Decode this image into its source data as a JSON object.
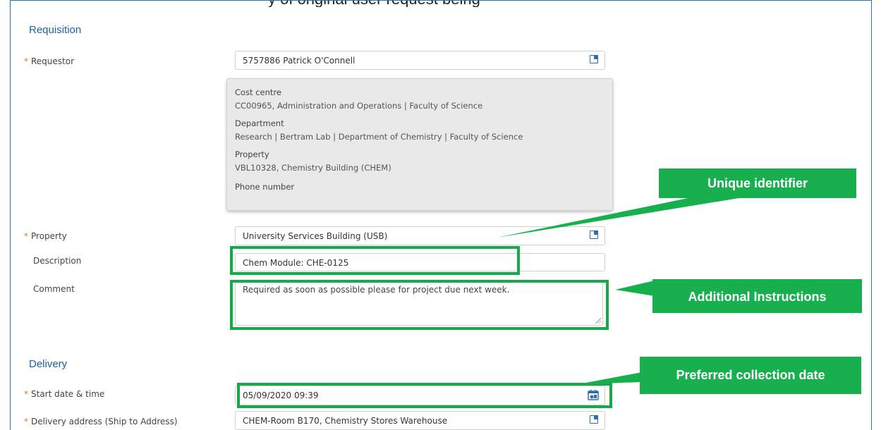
{
  "page": {
    "header_hint": "y of original user request being"
  },
  "requisition": {
    "section_title": "Requisition",
    "requestor": {
      "label": "Requestor",
      "value": "5757886 Patrick O'Connell"
    },
    "info": {
      "cost_centre_label": "Cost centre",
      "cost_centre_value": "CC00965, Administration and Operations | Faculty of Science",
      "department_label": "Department",
      "department_value": "Research | Bertram Lab | Department of Chemistry | Faculty of Science",
      "property_label": "Property",
      "property_value": "VBL10328, Chemistry Building (CHEM)",
      "phone_label": "Phone number"
    },
    "property": {
      "label": "Property",
      "value": "University Services Building (USB)"
    },
    "description": {
      "label": "Description",
      "value": "Chem Module: CHE-0125"
    },
    "comment": {
      "label": "Comment",
      "value": "Required as soon as possible please for project due next week."
    }
  },
  "delivery": {
    "section_title": "Delivery",
    "start": {
      "label": "Start date & time",
      "value": "05/09/2020 09:39"
    },
    "address": {
      "label": "Delivery address (Ship to Address)",
      "value": "CHEM-Room B170, Chemistry Stores Warehouse"
    }
  },
  "callouts": {
    "unique": "Unique identifier",
    "additional": "Additional Instructions",
    "preferred": "Preferred collection date"
  },
  "colors": {
    "accent": "#1a62a4",
    "highlight": "#18b04f",
    "required": "#e07a2a"
  },
  "icons": {
    "lookup": "lookup-icon",
    "calendar": "calendar-icon",
    "resize": "resize-handle-icon"
  }
}
